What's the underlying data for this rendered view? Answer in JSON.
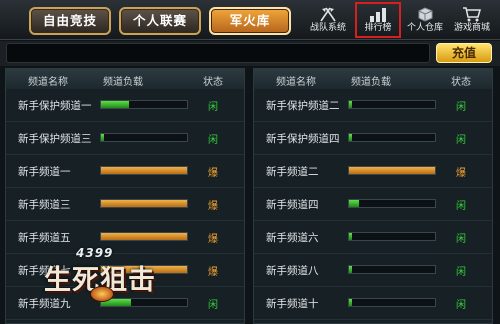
{
  "tabs": [
    {
      "label": "自由竞技",
      "active": false
    },
    {
      "label": "个人联赛",
      "active": false
    },
    {
      "label": "军火库",
      "active": true
    }
  ],
  "tools": [
    {
      "label": "战队系统",
      "icon": "crossed-flags-icon"
    },
    {
      "label": "排行榜",
      "icon": "bar-chart-icon",
      "highlighted": true
    },
    {
      "label": "个人仓库",
      "icon": "box-icon"
    },
    {
      "label": "游戏商城",
      "icon": "shopping-cart-icon"
    }
  ],
  "recharge_label": "充值",
  "columns": {
    "name": "频道名称",
    "load": "频道负载",
    "state": "状态"
  },
  "left_channels": [
    {
      "name": "新手保护频道一",
      "load": 0.33,
      "color": "green",
      "state": "闲"
    },
    {
      "name": "新手保护频道三",
      "load": 0.03,
      "color": "green",
      "state": "闲"
    },
    {
      "name": "新手频道一",
      "load": 1.0,
      "color": "orange",
      "state": "爆"
    },
    {
      "name": "新手频道三",
      "load": 1.0,
      "color": "orange",
      "state": "爆"
    },
    {
      "name": "新手频道五",
      "load": 1.0,
      "color": "orange",
      "state": "爆"
    },
    {
      "name": "新手频道七",
      "load": 1.0,
      "color": "orange",
      "state": "爆"
    },
    {
      "name": "新手频道九",
      "load": 0.35,
      "color": "green",
      "state": "闲"
    }
  ],
  "right_channels": [
    {
      "name": "新手保护频道二",
      "load": 0.03,
      "color": "green",
      "state": "闲"
    },
    {
      "name": "新手保护频道四",
      "load": 0.03,
      "color": "green",
      "state": "闲"
    },
    {
      "name": "新手频道二",
      "load": 1.0,
      "color": "orange",
      "state": "爆"
    },
    {
      "name": "新手频道四",
      "load": 0.12,
      "color": "green",
      "state": "闲"
    },
    {
      "name": "新手频道六",
      "load": 0.03,
      "color": "green",
      "state": "闲"
    },
    {
      "name": "新手频道八",
      "load": 0.03,
      "color": "green",
      "state": "闲"
    },
    {
      "name": "新手频道十",
      "load": 0.03,
      "color": "green",
      "state": "闲"
    }
  ],
  "logo": {
    "number": "4399",
    "title": "生死狙击"
  }
}
